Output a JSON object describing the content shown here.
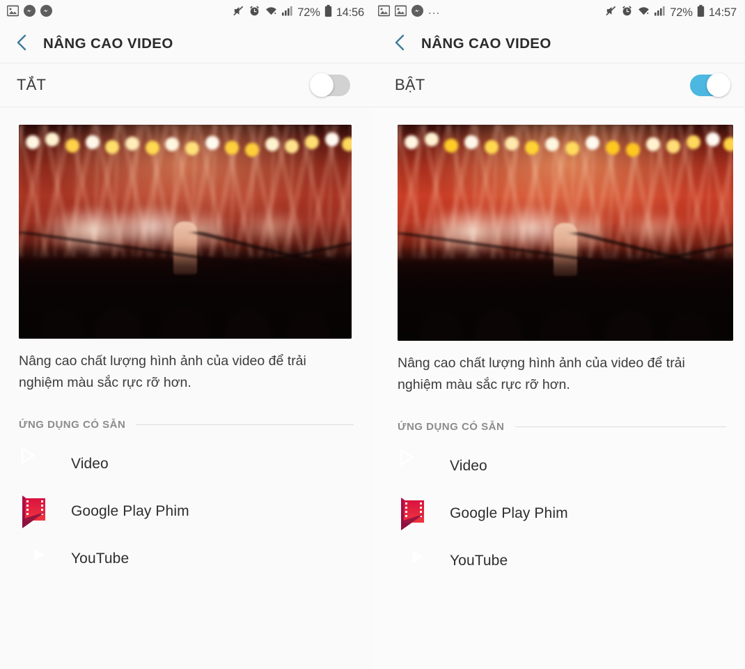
{
  "panels": [
    {
      "id": "left",
      "status_bar": {
        "notification_icons": [
          "gallery-icon",
          "messenger-icon",
          "messenger-icon"
        ],
        "mute_icon": "mute-icon",
        "alarm_icon": "alarm-icon",
        "wifi_icon": "wifi-icon",
        "signal_icon": "signal-bars-icon",
        "battery_percent": "72%",
        "battery_icon": "battery-icon",
        "clock": "14:56"
      },
      "appbar": {
        "back_icon": "back-chevron-icon",
        "title": "NÂNG CAO VIDEO"
      },
      "toggle": {
        "label": "TẮT",
        "state": "off"
      },
      "thumbnail": {
        "name": "concert-preview-image",
        "vivid": false
      },
      "description": "Nâng cao chất lượng hình ảnh của video để trải nghiệm màu sắc rực rỡ hơn.",
      "section": {
        "label": "ỨNG DỤNG CÓ SẴN"
      },
      "apps": [
        {
          "name": "Video",
          "icon": "samsung-video-icon"
        },
        {
          "name": "Google Play Phim",
          "icon": "google-play-movies-icon"
        },
        {
          "name": "YouTube",
          "icon": "youtube-icon"
        }
      ]
    },
    {
      "id": "right",
      "status_bar": {
        "notification_icons": [
          "gallery-icon",
          "gallery-icon",
          "messenger-icon"
        ],
        "overflow": "...",
        "mute_icon": "mute-icon",
        "alarm_icon": "alarm-icon",
        "wifi_icon": "wifi-icon",
        "signal_icon": "signal-bars-icon",
        "battery_percent": "72%",
        "battery_icon": "battery-icon",
        "clock": "14:57"
      },
      "appbar": {
        "back_icon": "back-chevron-icon",
        "title": "NÂNG CAO VIDEO"
      },
      "toggle": {
        "label": "BẬT",
        "state": "on"
      },
      "thumbnail": {
        "name": "concert-preview-image",
        "vivid": true
      },
      "description": "Nâng cao chất lượng hình ảnh của video để trải nghiệm màu sắc rực rỡ hơn.",
      "section": {
        "label": "ỨNG DỤNG CÓ SẴN"
      },
      "apps": [
        {
          "name": "Video",
          "icon": "samsung-video-icon"
        },
        {
          "name": "Google Play Phim",
          "icon": "google-play-movies-icon"
        },
        {
          "name": "YouTube",
          "icon": "youtube-icon"
        }
      ]
    }
  ],
  "colors": {
    "accent_blue": "#3c7b9b",
    "toggle_on": "#4cb7e0",
    "toggle_off": "#d2d2d2",
    "background": "#fafafa",
    "title_text": "#2b2b2b",
    "body_text": "#3b3b3b",
    "section_text": "#8c8c8c",
    "youtube_red": "#f61c0d",
    "video_purple": "#8f7dee"
  }
}
